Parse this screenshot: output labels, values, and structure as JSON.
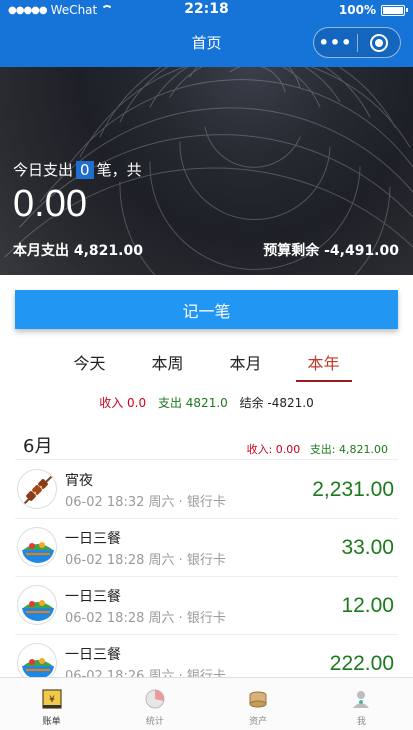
{
  "status_bar": {
    "carrier": "WeChat",
    "time": "22:18",
    "battery": "100%"
  },
  "nav": {
    "title": "首页",
    "more_label": "•••"
  },
  "hero": {
    "today_prefix": "今日支出",
    "today_count": "0",
    "today_suffix": "笔，共",
    "today_amount": "0.00",
    "month_expense": "本月支出 4,821.00",
    "budget_left": "预算剩余 -4,491.00"
  },
  "record_button": "记一笔",
  "tabs": [
    {
      "label": "今天"
    },
    {
      "label": "本周"
    },
    {
      "label": "本月"
    },
    {
      "label": "本年",
      "active": true
    }
  ],
  "summary": {
    "income": "收入 0.0",
    "expense": "支出 4821.0",
    "balance": "结余 -4821.0"
  },
  "month_group": {
    "label": "6月",
    "income": "收入: 0.00",
    "expense": "支出: 4,821.00"
  },
  "records": [
    {
      "title": "宵夜",
      "meta": "06-02 18:32 周六 · 银行卡",
      "amount": "2,231.00",
      "icon": "skewer-icon"
    },
    {
      "title": "一日三餐",
      "meta": "06-02 18:28 周六 · 银行卡",
      "amount": "33.00",
      "icon": "meal-bowl-icon"
    },
    {
      "title": "一日三餐",
      "meta": "06-02 18:28 周六 · 银行卡",
      "amount": "12.00",
      "icon": "meal-bowl-icon"
    },
    {
      "title": "一日三餐",
      "meta": "06-02 18:26 周六 · 银行卡",
      "amount": "222.00",
      "icon": "meal-bowl-icon"
    }
  ],
  "tabbar": [
    {
      "label": "账单",
      "icon": "ledger-icon",
      "active": true
    },
    {
      "label": "统计",
      "icon": "pie-chart-icon"
    },
    {
      "label": "资产",
      "icon": "coins-icon"
    },
    {
      "label": "我",
      "icon": "user-icon"
    }
  ],
  "colors": {
    "primary": "#1673d8",
    "button": "#2196f3",
    "income": "#d0021b",
    "expense": "#1b7a1b",
    "tab_active": "#c0392b"
  }
}
